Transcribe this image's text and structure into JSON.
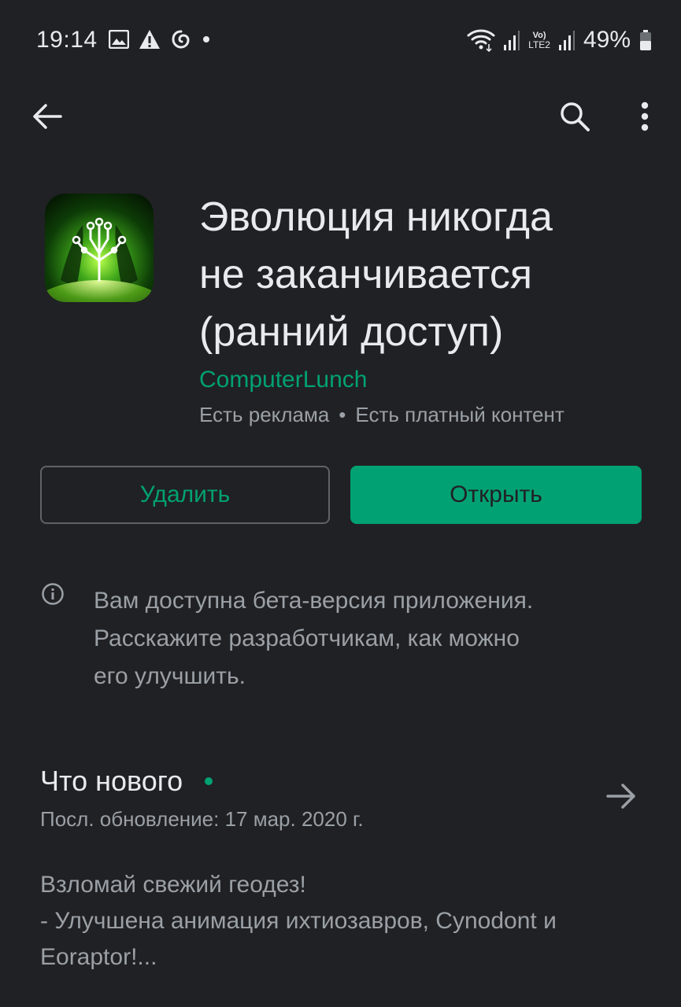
{
  "status_bar": {
    "time": "19:14",
    "battery_percent": "49%",
    "network_label": "LTE2",
    "left_icons": [
      "gallery-icon",
      "alert-icon",
      "swirl-icon",
      "dot-icon"
    ],
    "right_icons": [
      "wifi-icon",
      "signal-icon",
      "volte-icon",
      "signal-icon",
      "battery-icon"
    ]
  },
  "toolbar": {
    "back_icon": "back-arrow-icon",
    "search_icon": "search-icon",
    "menu_icon": "more-vert-icon"
  },
  "app": {
    "title_line1": "Эволюция никогда",
    "title_line2": "не заканчивается",
    "title_line3": "(ранний доступ)",
    "developer": "ComputerLunch",
    "meta_ads": "Есть реклама",
    "meta_separator": "•",
    "meta_paid": "Есть платный контент"
  },
  "actions": {
    "uninstall_label": "Удалить",
    "open_label": "Открыть"
  },
  "beta": {
    "line1": "Вам доступна бета-версия приложения.",
    "line2": "Расскажите разработчикам, как можно",
    "line3": "его улучшить."
  },
  "whats_new": {
    "title": "Что нового",
    "last_update": "Посл. обновление: 17 мар. 2020 г.",
    "line1": "Взломай свежий геодез!",
    "line2": "- Улучшена анимация ихтиозавров, Cynodont и",
    "line3": "Eoraptor!..."
  },
  "colors": {
    "background": "#202124",
    "accent": "#01a173",
    "text_primary": "#e8eaed",
    "text_secondary": "#9aa0a6"
  }
}
